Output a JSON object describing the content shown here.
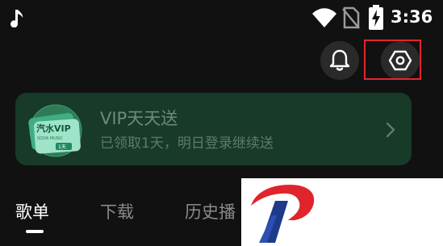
{
  "status_bar": {
    "time": "3:36",
    "icons": [
      "app-notification-icon",
      "wifi-icon",
      "no-sim-icon",
      "battery-charging-icon"
    ]
  },
  "header": {
    "actions": [
      {
        "name": "notifications",
        "icon": "bell-icon"
      },
      {
        "name": "settings",
        "icon": "hexagon-settings-icon",
        "highlighted": true
      }
    ]
  },
  "vip_banner": {
    "title": "VIP天天送",
    "subtitle": "已领取1天，明日登录继续送",
    "card_text": "汽水VIP",
    "card_subtext": "SODA MUSIC",
    "card_badge": "1天",
    "chevron_icon": "chevron-right-icon"
  },
  "tabs": [
    {
      "label": "歌单",
      "active": true
    },
    {
      "label": "下载",
      "active": false
    },
    {
      "label": "历史播"
    }
  ],
  "colors": {
    "background": "#111111",
    "banner_bg": "#173a29",
    "highlight": "#e5252d",
    "watermark_red": "#e0242c",
    "watermark_blue": "#1e3a8a"
  }
}
